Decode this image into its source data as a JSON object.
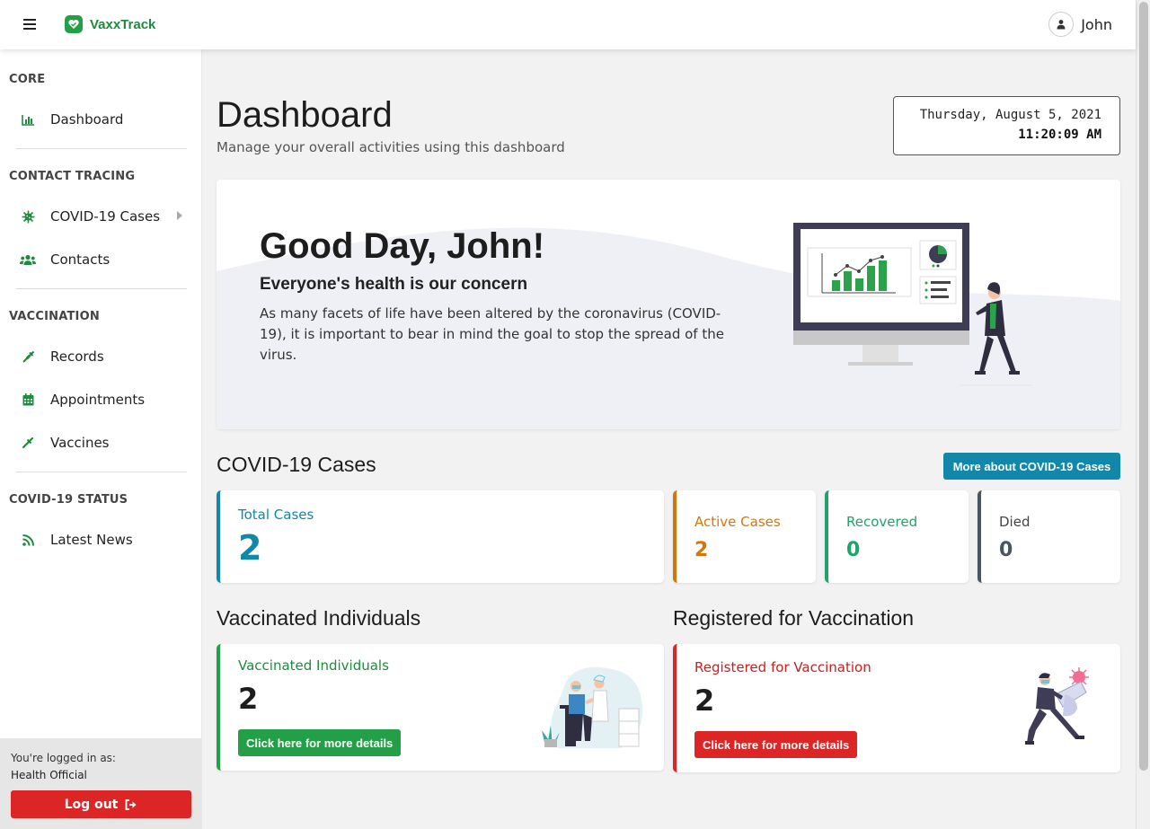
{
  "app": {
    "name": "VaxxTrack"
  },
  "user": {
    "name": "John"
  },
  "sidebar": {
    "sections": [
      {
        "heading": "CORE"
      },
      {
        "heading": "CONTACT TRACING"
      },
      {
        "heading": "VACCINATION"
      },
      {
        "heading": "COVID-19 STATUS"
      }
    ],
    "items": [
      {
        "label": "Dashboard",
        "icon": "chart-bar-icon"
      },
      {
        "label": "COVID-19 Cases",
        "icon": "virus-icon"
      },
      {
        "label": "Contacts",
        "icon": "users-icon"
      },
      {
        "label": "Records",
        "icon": "syringe-icon"
      },
      {
        "label": "Appointments",
        "icon": "calendar-icon"
      },
      {
        "label": "Vaccines",
        "icon": "eyedropper-icon"
      },
      {
        "label": "Latest News",
        "icon": "rss-icon"
      }
    ],
    "footer": {
      "logged_in_label": "You're logged in as:",
      "role": "Health Official",
      "logout_label": "Log out"
    }
  },
  "main": {
    "title": "Dashboard",
    "subtitle": "Manage your overall activities using this dashboard",
    "clock": {
      "date": "Thursday, August 5, 2021",
      "time": "11:20:09 AM"
    },
    "hero": {
      "title": "Good Day, John!",
      "subtitle": "Everyone's health is our concern",
      "text": "As many facets of life have been altered by the coronavirus (COVID-19), it is important to bear in mind the goal to stop the spread of the virus."
    },
    "cases": {
      "title": "COVID-19 Cases",
      "more_label": "More about COVID-19 Cases",
      "total": {
        "label": "Total Cases",
        "value": "2"
      },
      "active": {
        "label": "Active Cases",
        "value": "2"
      },
      "recovered": {
        "label": "Recovered",
        "value": "0"
      },
      "died": {
        "label": "Died",
        "value": "0"
      }
    },
    "vaccinated": {
      "title": "Vaccinated Individuals",
      "card_label": "Vaccinated Individuals",
      "value": "2",
      "button_label": "Click here for more details"
    },
    "registered": {
      "title": "Registered for Vaccination",
      "card_label": "Registered for Vaccination",
      "value": "2",
      "button_label": "Click here for more details"
    }
  },
  "colors": {
    "brand_green": "#1e8b3d",
    "info_blue": "#1187a9",
    "warning_orange": "#d4770b",
    "success_green": "#1fa36b",
    "dark": "#4a5563",
    "danger_red": "#dc2626"
  }
}
